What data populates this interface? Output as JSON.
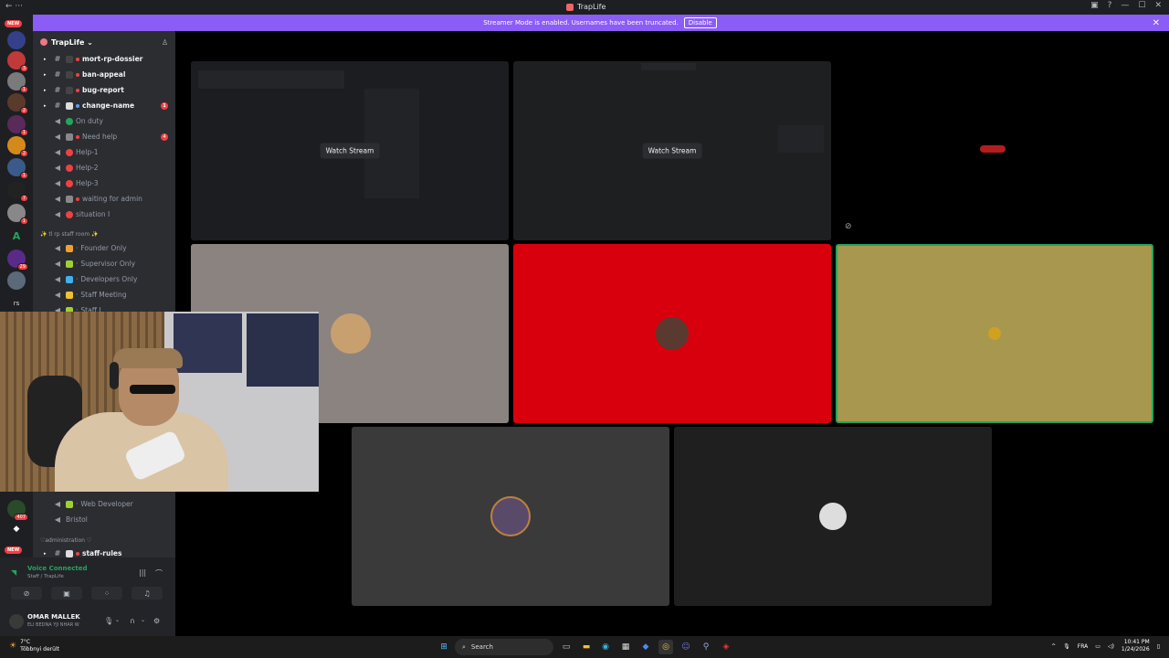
{
  "window": {
    "title": "TrapLife",
    "nav": "← ···"
  },
  "banner": {
    "text": "Streamer Mode is enabled. Usernames have been truncated.",
    "disable": "Disable",
    "close": "✕"
  },
  "guild_rail": {
    "new_top": "NEW",
    "new_bottom": "NEW",
    "badges": [
      "3",
      "1",
      "2",
      "1",
      "2",
      "1",
      "7",
      "1",
      "29",
      "407"
    ]
  },
  "server": {
    "name": "TrapLife ⌄"
  },
  "channels": [
    {
      "label": "mort-rp-dossier",
      "type": "text"
    },
    {
      "label": "ban-appeal",
      "type": "text"
    },
    {
      "label": "bug-report",
      "type": "text"
    },
    {
      "label": "change-name",
      "type": "text",
      "badge": "1"
    },
    {
      "label": "On duty",
      "type": "voice"
    },
    {
      "label": "Need help",
      "type": "voice",
      "badge": "4"
    },
    {
      "label": "Help-1",
      "type": "voice"
    },
    {
      "label": "Help-2",
      "type": "voice"
    },
    {
      "label": "Help-3",
      "type": "voice"
    },
    {
      "label": "waiting for admin",
      "type": "voice"
    },
    {
      "label": "situation I",
      "type": "voice"
    }
  ],
  "staff_category": "✨ tl rp staff room ✨",
  "staff_channels": [
    {
      "label": "Founder Only"
    },
    {
      "label": "Supervisor Only"
    },
    {
      "label": "Developers Only"
    },
    {
      "label": "Staff Meeting"
    },
    {
      "label": "Staff I"
    }
  ],
  "lower_channels": [
    {
      "label": "Web Developer"
    },
    {
      "label": "Bristol"
    }
  ],
  "admin_category": "♡administration ♡",
  "staff_rules": "staff-rules",
  "voice": {
    "status": "Voice Connected",
    "sub": "Staff / TrapLife"
  },
  "user": {
    "name": "OMAR MALLEK",
    "status": "ELI BEDNA YJI NHAR W"
  },
  "stage": {
    "watch_label": "Watch Stream",
    "tiles_colors": {
      "gray": "#8a8380",
      "red": "#d9000d",
      "olive": "#a8974e",
      "dark1": "#3a3a3a",
      "dark2": "#1f1f1f"
    }
  },
  "taskbar": {
    "temp": "7°C",
    "weather": "Többnyi derült",
    "search": "Search",
    "lang": "FRA",
    "time": "10:41 PM",
    "date": "1/24/2026"
  }
}
